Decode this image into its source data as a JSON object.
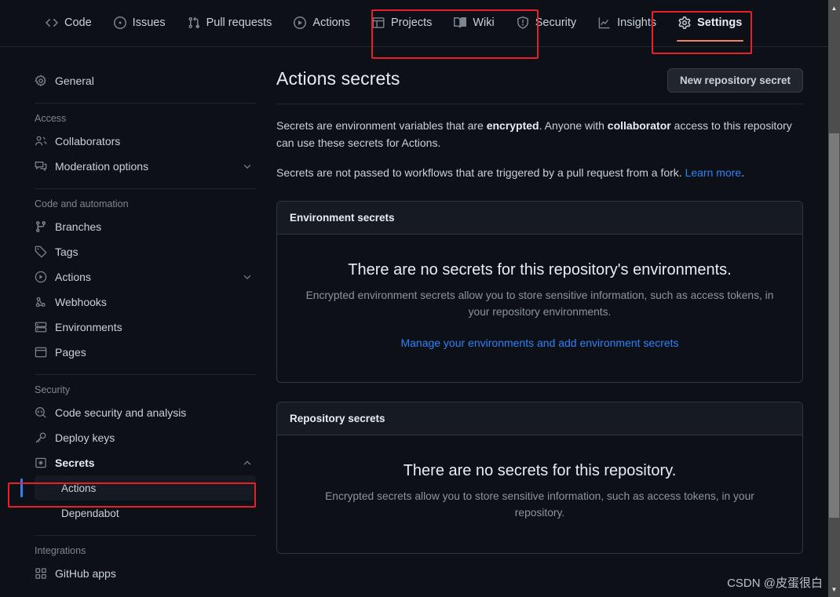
{
  "repo_nav": {
    "items": [
      {
        "label": "Code",
        "icon": "code-icon",
        "selected": false
      },
      {
        "label": "Issues",
        "icon": "issue-opened-icon",
        "selected": false
      },
      {
        "label": "Pull requests",
        "icon": "git-pull-request-icon",
        "selected": false
      },
      {
        "label": "Actions",
        "icon": "play-icon",
        "selected": false
      },
      {
        "label": "Projects",
        "icon": "table-icon",
        "selected": false
      },
      {
        "label": "Wiki",
        "icon": "book-icon",
        "selected": false
      },
      {
        "label": "Security",
        "icon": "shield-icon",
        "selected": false
      },
      {
        "label": "Insights",
        "icon": "graph-icon",
        "selected": false
      },
      {
        "label": "Settings",
        "icon": "gear-icon",
        "selected": true
      }
    ]
  },
  "sidebar": {
    "general": {
      "label": "General",
      "icon": "gear-icon"
    },
    "sections": [
      {
        "title": "Access",
        "items": [
          {
            "label": "Collaborators",
            "icon": "people-icon",
            "chevron": ""
          },
          {
            "label": "Moderation options",
            "icon": "comment-icon",
            "chevron": "down"
          }
        ]
      },
      {
        "title": "Code and automation",
        "items": [
          {
            "label": "Branches",
            "icon": "git-branch-icon",
            "chevron": ""
          },
          {
            "label": "Tags",
            "icon": "tag-icon",
            "chevron": ""
          },
          {
            "label": "Actions",
            "icon": "play-icon",
            "chevron": "down"
          },
          {
            "label": "Webhooks",
            "icon": "webhook-icon",
            "chevron": ""
          },
          {
            "label": "Environments",
            "icon": "server-icon",
            "chevron": ""
          },
          {
            "label": "Pages",
            "icon": "browser-icon",
            "chevron": ""
          }
        ]
      },
      {
        "title": "Security",
        "items": [
          {
            "label": "Code security and analysis",
            "icon": "codescan-icon",
            "chevron": ""
          },
          {
            "label": "Deploy keys",
            "icon": "key-icon",
            "chevron": ""
          },
          {
            "label": "Secrets",
            "icon": "secret-icon",
            "chevron": "up",
            "bold": true
          }
        ],
        "sub_items": [
          {
            "label": "Actions",
            "active": true
          },
          {
            "label": "Dependabot",
            "active": false
          }
        ]
      },
      {
        "title": "Integrations",
        "items": [
          {
            "label": "GitHub apps",
            "icon": "apps-icon",
            "chevron": ""
          }
        ]
      }
    ]
  },
  "main": {
    "title": "Actions secrets",
    "new_secret_button": "New repository secret",
    "intro_1_a": "Secrets are environment variables that are ",
    "intro_1_b": "encrypted",
    "intro_1_c": ". Anyone with ",
    "intro_1_d": "collaborator",
    "intro_1_e": " access to this repository can use these secrets for Actions.",
    "intro_2_a": "Secrets are not passed to workflows that are triggered by a pull request from a fork. ",
    "intro_2_link": "Learn more",
    "intro_2_end": ".",
    "panels": [
      {
        "header": "Environment secrets",
        "blank_title": "There are no secrets for this repository's environments.",
        "blank_desc": "Encrypted environment secrets allow you to store sensitive information, such as access tokens, in your repository environments.",
        "blank_link": "Manage your environments and add environment secrets"
      },
      {
        "header": "Repository secrets",
        "blank_title": "There are no secrets for this repository.",
        "blank_desc": "Encrypted secrets allow you to store sensitive information, such as access tokens, in your repository.",
        "blank_link": ""
      }
    ]
  },
  "scrollbar": {
    "up_arrow": "▲",
    "down_arrow": "▼"
  },
  "watermark": "CSDN @皮蛋很白",
  "colors": {
    "background": "#0d1117",
    "panel_header": "#161b22",
    "border": "#30363d",
    "text": "#c9d1d9",
    "muted": "#8b949e",
    "link": "#2f81f7",
    "accent_underline": "#f78166",
    "highlight_box": "#e8202a",
    "active_bar": "#2f81f7"
  }
}
